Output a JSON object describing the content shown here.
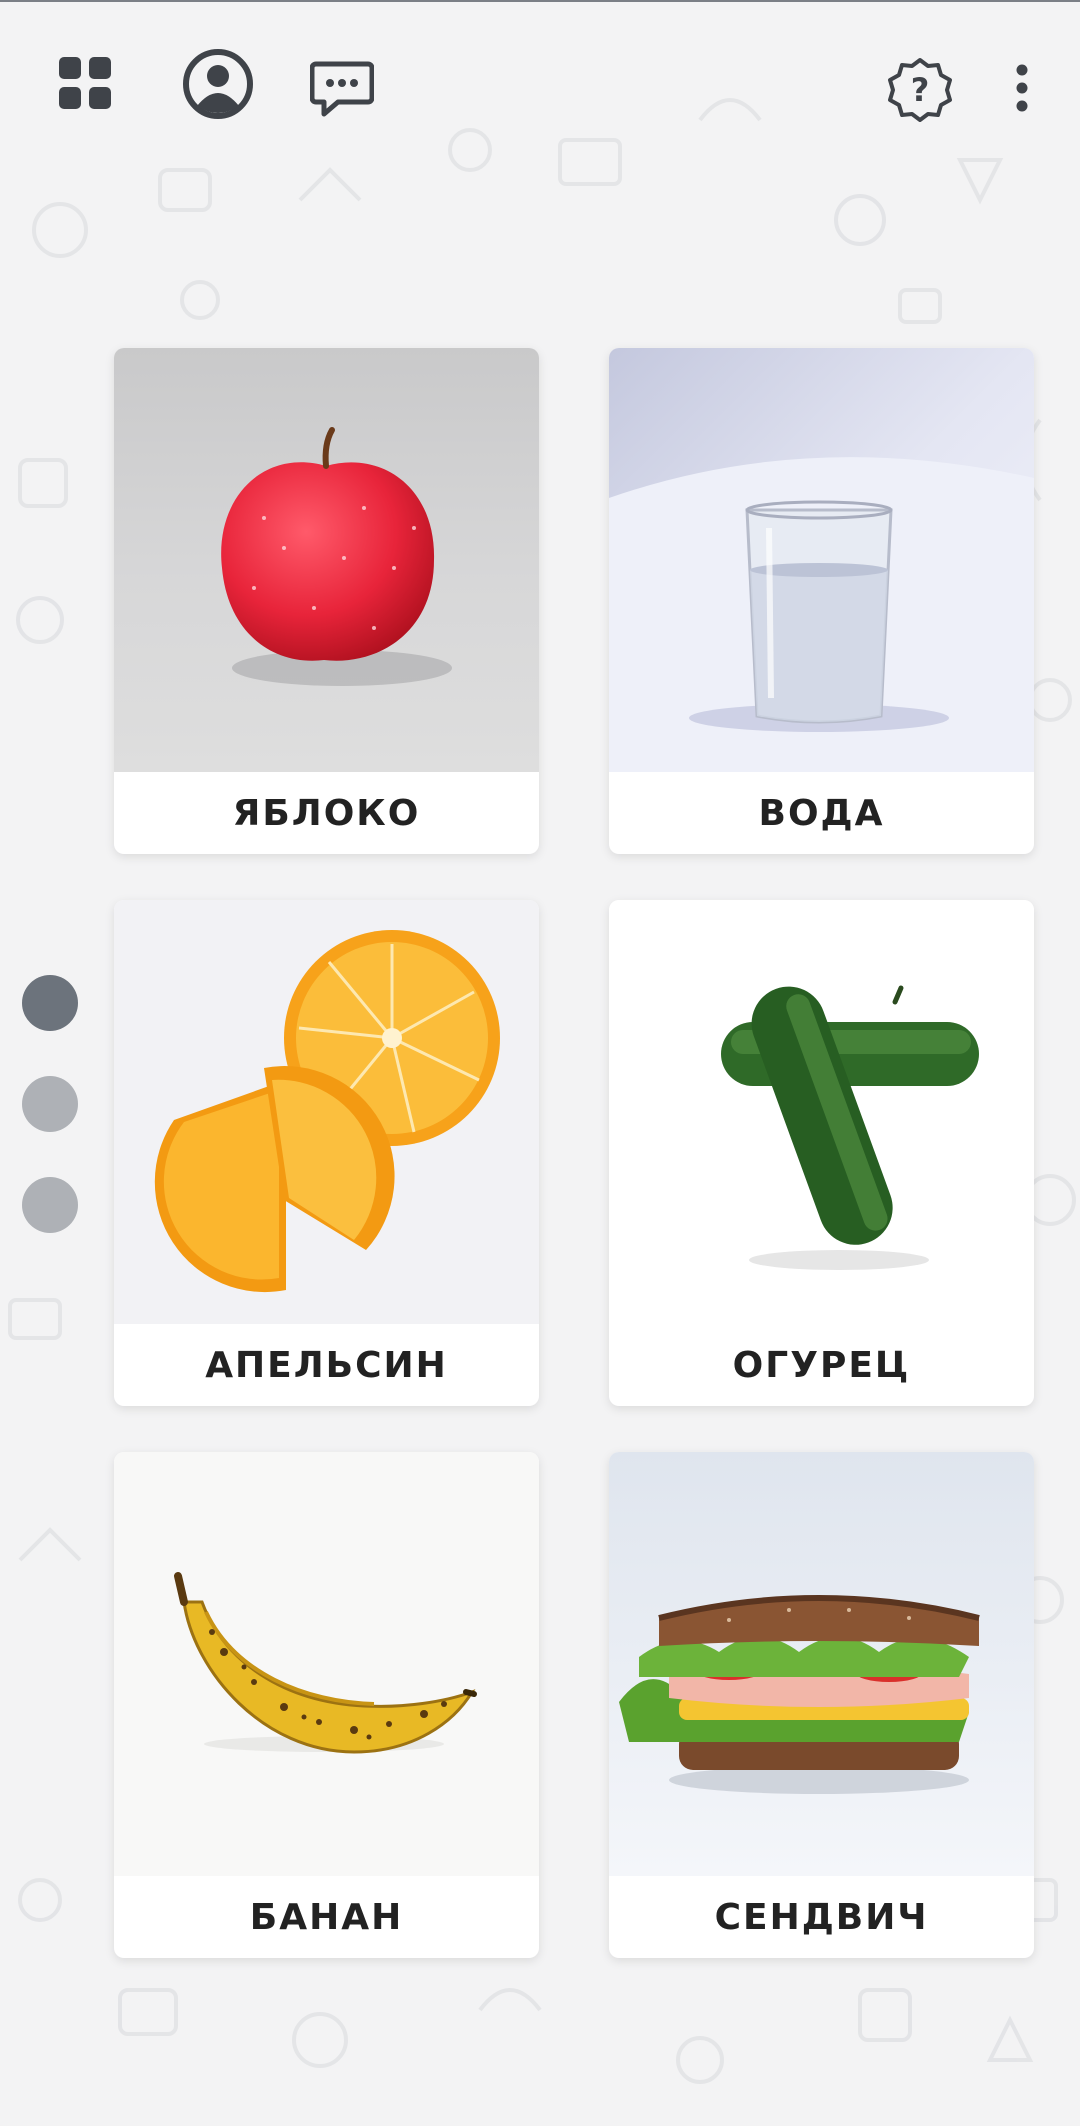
{
  "toolbar": {
    "icons": [
      "grid-icon",
      "profile-icon",
      "chat-icon",
      "help-icon",
      "more-vertical-icon"
    ],
    "help_glyph": "?"
  },
  "pager": {
    "count": 3,
    "active_index": 0
  },
  "cards": [
    {
      "label": "ЯБЛОКО",
      "image": "apple"
    },
    {
      "label": "ВОДА",
      "image": "glass-of-water"
    },
    {
      "label": "АПЕЛЬСИН",
      "image": "orange"
    },
    {
      "label": "ОГУРЕЦ",
      "image": "cucumber"
    },
    {
      "label": "БАНАН",
      "image": "banana"
    },
    {
      "label": "СЕНДВИЧ",
      "image": "sandwich"
    }
  ],
  "colors": {
    "background": "#f3f3f4",
    "icon": "#3f4349",
    "dot_active": "#6c737c",
    "dot_inactive": "#aeb1b6",
    "label_text": "#222222"
  }
}
